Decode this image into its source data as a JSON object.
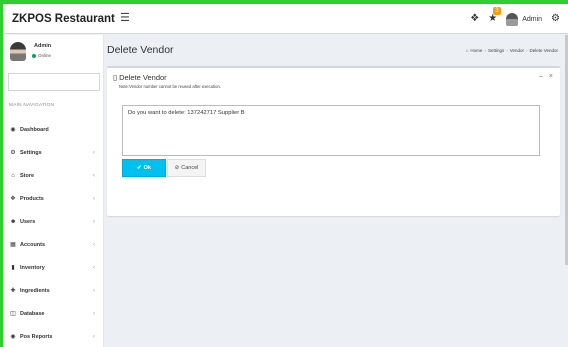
{
  "app": {
    "logo": "ZKPOS Restaurant"
  },
  "header": {
    "menu_icon": "hamburger-icon",
    "notification_count": "3",
    "user_label": "Admin"
  },
  "sidebar": {
    "user": {
      "name": "Admin",
      "status": "Online",
      "status_color": "#00a65a"
    },
    "search_placeholder": "",
    "section_header": "MAIN NAVIGATION",
    "items": [
      {
        "label": "Dashboard",
        "icon": "dashboard-icon",
        "has_children": false
      },
      {
        "label": "Settings",
        "icon": "gear-icon",
        "has_children": true
      },
      {
        "label": "Store",
        "icon": "home-icon",
        "has_children": true
      },
      {
        "label": "Products",
        "icon": "cube-icon",
        "has_children": true
      },
      {
        "label": "Users",
        "icon": "users-icon",
        "has_children": true
      },
      {
        "label": "Accounts",
        "icon": "calculator-icon",
        "has_children": true
      },
      {
        "label": "Inventory",
        "icon": "barcode-icon",
        "has_children": true
      },
      {
        "label": "Ingredients",
        "icon": "plus-icon",
        "has_children": true
      },
      {
        "label": "Database",
        "icon": "database-icon",
        "has_children": true
      },
      {
        "label": "Pos Reports",
        "icon": "eye-icon",
        "has_children": true
      }
    ]
  },
  "main": {
    "page_title": "Delete Vendor",
    "breadcrumb": [
      "Home",
      "Settings",
      "Vendor",
      "Delete Vendor"
    ],
    "box": {
      "title": "Delete Vendor",
      "note": "Note:Vendor number cannot be reused after execution.",
      "message": "Do you want to delete: 137242717 Supplier B",
      "ok_label": "Ok",
      "cancel_label": "Cancel"
    }
  },
  "colors": {
    "accent": "#00c0ef",
    "frame": "#33cc33",
    "badge": "#f39c12"
  }
}
